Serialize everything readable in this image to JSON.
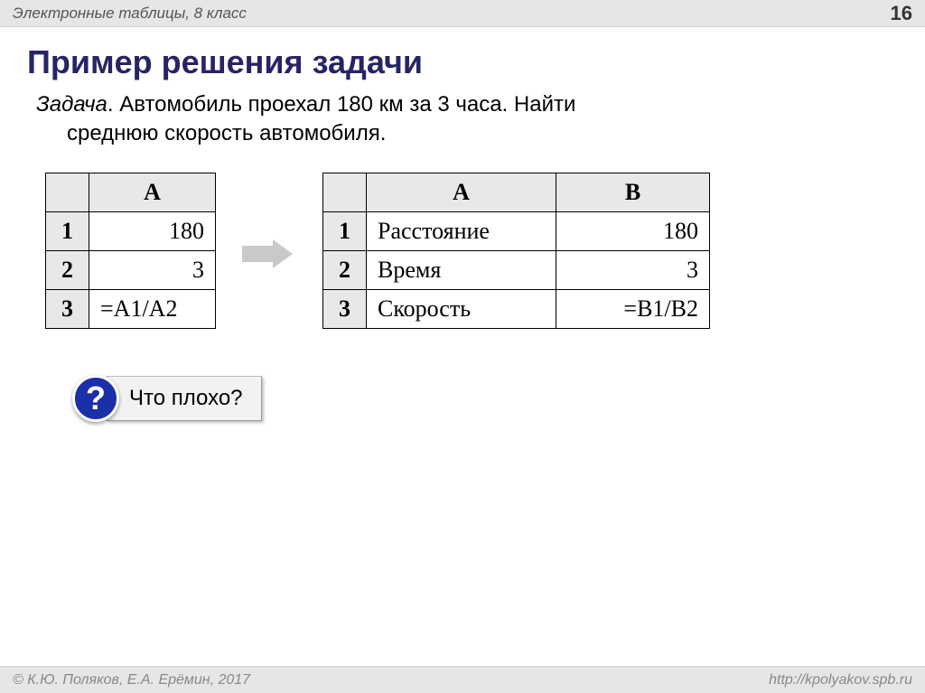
{
  "header": {
    "subject": "Электронные таблицы, 8 класс",
    "page_number": "16"
  },
  "title": "Пример решения задачи",
  "task": {
    "label": "Задача",
    "sep": ". ",
    "line1": "Автомобиль проехал 180 км за 3 часа. Найти",
    "line2": "среднюю скорость автомобиля."
  },
  "table1": {
    "colA": "A",
    "rows": [
      {
        "n": "1",
        "a": "180"
      },
      {
        "n": "2",
        "a": "3"
      },
      {
        "n": "3",
        "a": "=A1/A2"
      }
    ]
  },
  "table2": {
    "colA": "A",
    "colB": "B",
    "rows": [
      {
        "n": "1",
        "a": "Расстояние",
        "b": "180"
      },
      {
        "n": "2",
        "a": "Время",
        "b": "3"
      },
      {
        "n": "3",
        "a": "Скорость",
        "b": "=B1/B2"
      }
    ]
  },
  "question": {
    "mark": "?",
    "text": "Что плохо?"
  },
  "footer": {
    "copyright": "© К.Ю. Поляков, Е.А. Ерёмин, 2017",
    "url": "http://kpolyakov.spb.ru"
  }
}
